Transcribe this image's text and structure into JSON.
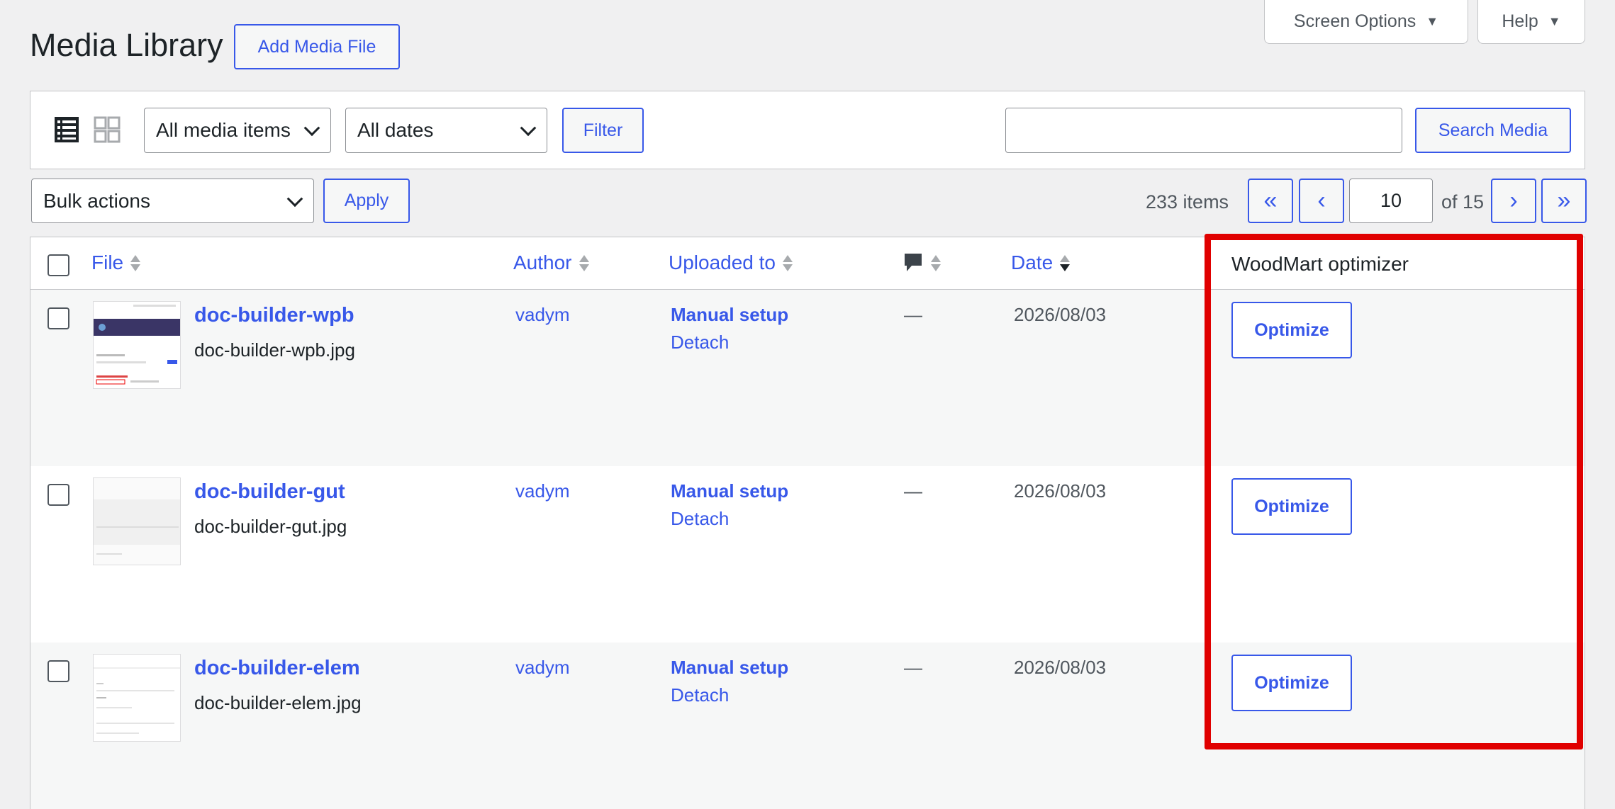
{
  "screen_meta": {
    "screen_options": "Screen Options",
    "help": "Help",
    "arrow": "▼"
  },
  "header": {
    "title": "Media Library",
    "add_button": "Add Media File"
  },
  "filters": {
    "type_select": "All media items",
    "date_select": "All dates",
    "filter_button": "Filter",
    "search_value": "",
    "search_button": "Search Media"
  },
  "bulk": {
    "select": "Bulk actions",
    "apply": "Apply"
  },
  "pagination": {
    "count": "233 items",
    "first": "«",
    "prev": "‹",
    "current": "10",
    "of": "of 15",
    "next": "›",
    "last": "»"
  },
  "columns": {
    "file": "File",
    "author": "Author",
    "uploaded_to": "Uploaded to",
    "date": "Date",
    "optimizer": "WoodMart optimizer"
  },
  "rows": [
    {
      "title": "doc-builder-wpb",
      "filename": "doc-builder-wpb.jpg",
      "author": "vadym",
      "uploaded_to": "Manual setup",
      "detach": "Detach",
      "comments": "—",
      "date": "2026/08/03",
      "action": "Optimize"
    },
    {
      "title": "doc-builder-gut",
      "filename": "doc-builder-gut.jpg",
      "author": "vadym",
      "uploaded_to": "Manual setup",
      "detach": "Detach",
      "comments": "—",
      "date": "2026/08/03",
      "action": "Optimize"
    },
    {
      "title": "doc-builder-elem",
      "filename": "doc-builder-elem.jpg",
      "author": "vadym",
      "uploaded_to": "Manual setup",
      "detach": "Detach",
      "comments": "—",
      "date": "2026/08/03",
      "action": "Optimize"
    }
  ],
  "colors": {
    "link": "#3858e9",
    "highlight": "#e00000",
    "border": "#c3c4c7"
  }
}
